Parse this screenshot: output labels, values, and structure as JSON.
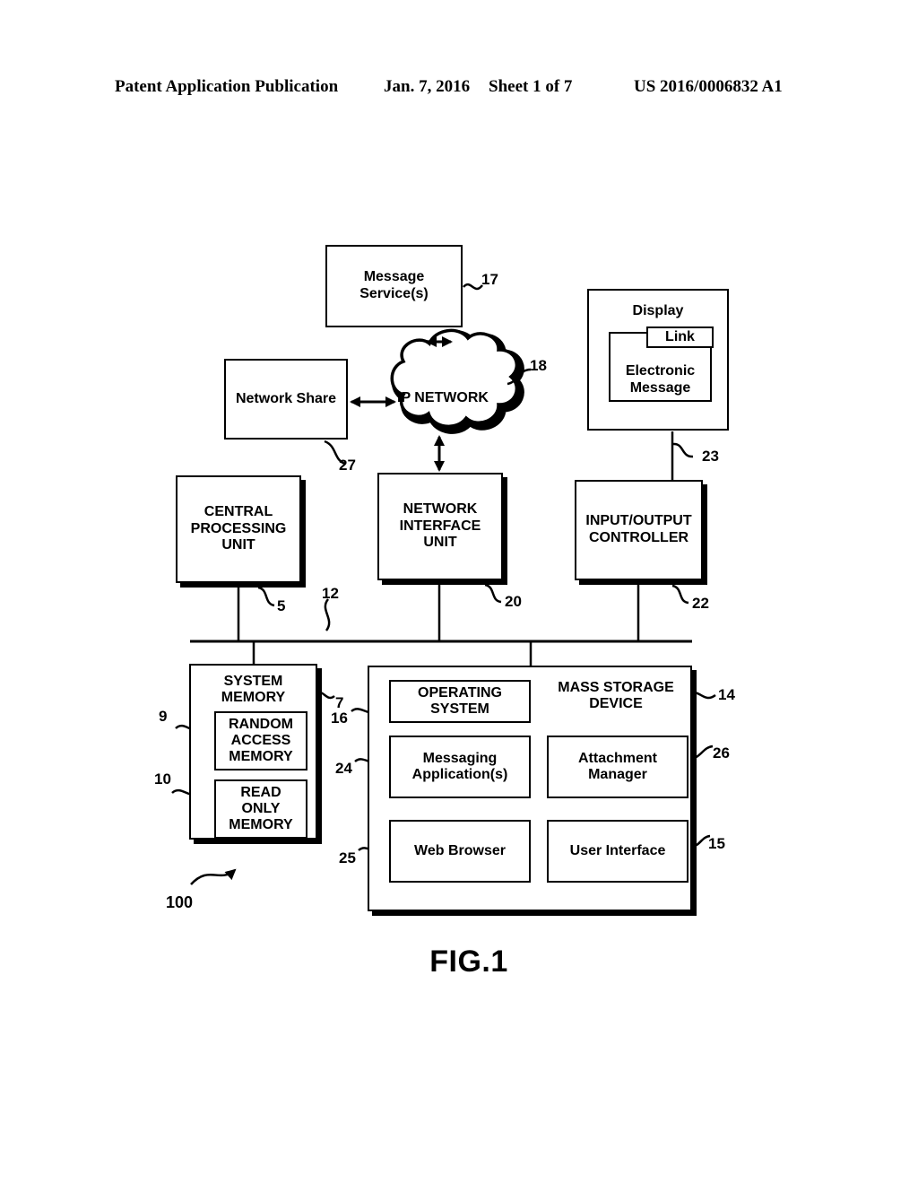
{
  "header": {
    "publication": "Patent Application Publication",
    "date": "Jan. 7, 2016",
    "sheet": "Sheet 1 of 7",
    "patent_number": "US 2016/0006832 A1"
  },
  "figure": {
    "caption": "FIG.1",
    "system_ref": "100"
  },
  "nodes": {
    "message_service": {
      "label": "Message\nService(s)",
      "ref": "17"
    },
    "network_share": {
      "label": "Network Share",
      "ref": "27"
    },
    "ip_network": {
      "label": "IP NETWORK",
      "ref": "18"
    },
    "display": {
      "label": "Display",
      "ref": "23"
    },
    "electronic_message": {
      "label": "Electronic\nMessage"
    },
    "link": {
      "label": "Link"
    },
    "cpu": {
      "label": "CENTRAL\nPROCESSING\nUNIT",
      "ref": "5"
    },
    "network_interface_unit": {
      "label": "NETWORK\nINTERFACE\nUNIT",
      "ref": "20"
    },
    "io_controller": {
      "label": "INPUT/OUTPUT\nCONTROLLER",
      "ref": "22"
    },
    "bus": {
      "ref": "12"
    },
    "system_memory": {
      "label": "SYSTEM\nMEMORY",
      "ref": "7"
    },
    "ram": {
      "label": "RANDOM\nACCESS\nMEMORY",
      "ref": "9"
    },
    "rom": {
      "label": "READ\nONLY\nMEMORY",
      "ref": "10"
    },
    "mass_storage": {
      "label": "MASS STORAGE\nDEVICE",
      "ref": "14"
    },
    "operating_system": {
      "label": "OPERATING\nSYSTEM",
      "ref": "16"
    },
    "messaging_applications": {
      "label": "Messaging\nApplication(s)",
      "ref": "24"
    },
    "web_browser": {
      "label": "Web Browser",
      "ref": "25"
    },
    "attachment_manager": {
      "label": "Attachment\nManager",
      "ref": "26"
    },
    "user_interface": {
      "label": "User Interface",
      "ref": "15"
    }
  },
  "colors": {
    "ink": "#000000",
    "paper": "#ffffff"
  }
}
